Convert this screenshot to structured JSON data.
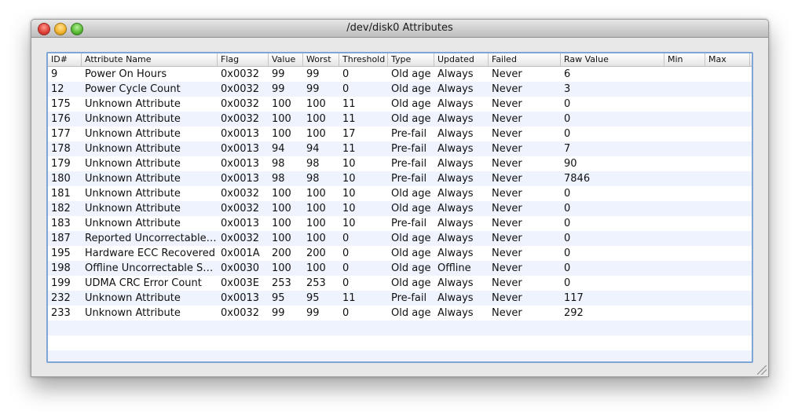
{
  "window": {
    "title": "/dev/disk0 Attributes"
  },
  "table": {
    "columns": [
      "ID#",
      "Attribute Name",
      "Flag",
      "Value",
      "Worst",
      "Threshold",
      "Type",
      "Updated",
      "Failed",
      "Raw Value",
      "Min",
      "Max"
    ],
    "rows": [
      [
        "9",
        "Power On Hours",
        "0x0032",
        "99",
        "99",
        "0",
        "Old age",
        "Always",
        "Never",
        "6",
        "",
        ""
      ],
      [
        "12",
        "Power Cycle Count",
        "0x0032",
        "99",
        "99",
        "0",
        "Old age",
        "Always",
        "Never",
        "3",
        "",
        ""
      ],
      [
        "175",
        "Unknown Attribute",
        "0x0032",
        "100",
        "100",
        "11",
        "Old age",
        "Always",
        "Never",
        "0",
        "",
        ""
      ],
      [
        "176",
        "Unknown Attribute",
        "0x0032",
        "100",
        "100",
        "11",
        "Old age",
        "Always",
        "Never",
        "0",
        "",
        ""
      ],
      [
        "177",
        "Unknown Attribute",
        "0x0013",
        "100",
        "100",
        "17",
        "Pre-fail",
        "Always",
        "Never",
        "0",
        "",
        ""
      ],
      [
        "178",
        "Unknown Attribute",
        "0x0013",
        "94",
        "94",
        "11",
        "Pre-fail",
        "Always",
        "Never",
        "7",
        "",
        ""
      ],
      [
        "179",
        "Unknown Attribute",
        "0x0013",
        "98",
        "98",
        "10",
        "Pre-fail",
        "Always",
        "Never",
        "90",
        "",
        ""
      ],
      [
        "180",
        "Unknown Attribute",
        "0x0013",
        "98",
        "98",
        "10",
        "Pre-fail",
        "Always",
        "Never",
        "7846",
        "",
        ""
      ],
      [
        "181",
        "Unknown Attribute",
        "0x0032",
        "100",
        "100",
        "10",
        "Old age",
        "Always",
        "Never",
        "0",
        "",
        ""
      ],
      [
        "182",
        "Unknown Attribute",
        "0x0032",
        "100",
        "100",
        "10",
        "Old age",
        "Always",
        "Never",
        "0",
        "",
        ""
      ],
      [
        "183",
        "Unknown Attribute",
        "0x0013",
        "100",
        "100",
        "10",
        "Pre-fail",
        "Always",
        "Never",
        "0",
        "",
        ""
      ],
      [
        "187",
        "Reported Uncorrectable …",
        "0x0032",
        "100",
        "100",
        "0",
        "Old age",
        "Always",
        "Never",
        "0",
        "",
        ""
      ],
      [
        "195",
        "Hardware ECC Recovered",
        "0x001A",
        "200",
        "200",
        "0",
        "Old age",
        "Always",
        "Never",
        "0",
        "",
        ""
      ],
      [
        "198",
        "Offline Uncorrectable Se…",
        "0x0030",
        "100",
        "100",
        "0",
        "Old age",
        "Offline",
        "Never",
        "0",
        "",
        ""
      ],
      [
        "199",
        "UDMA CRC Error Count",
        "0x003E",
        "253",
        "253",
        "0",
        "Old age",
        "Always",
        "Never",
        "0",
        "",
        ""
      ],
      [
        "232",
        "Unknown Attribute",
        "0x0013",
        "95",
        "95",
        "11",
        "Pre-fail",
        "Always",
        "Never",
        "117",
        "",
        ""
      ],
      [
        "233",
        "Unknown Attribute",
        "0x0032",
        "99",
        "99",
        "0",
        "Old age",
        "Always",
        "Never",
        "292",
        "",
        ""
      ]
    ],
    "empty_rows": 3
  },
  "icons": {
    "close": "close-button-icon",
    "minimize": "minimize-button-icon",
    "zoom": "zoom-button-icon",
    "resize": "resize-grip-icon"
  },
  "colors": {
    "alt_row": "#eef3fd",
    "focus_ring": "#7fa4d6"
  }
}
